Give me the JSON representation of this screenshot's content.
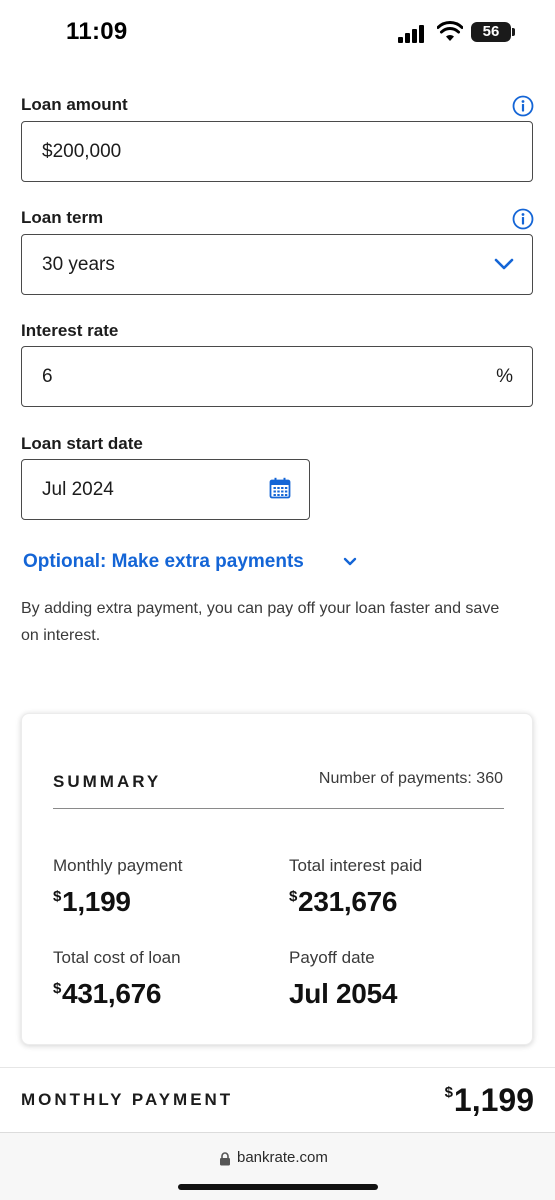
{
  "status_bar": {
    "time": "11:09",
    "battery": "56"
  },
  "form": {
    "loan_amount": {
      "label": "Loan amount",
      "value": "$200,000"
    },
    "loan_term": {
      "label": "Loan term",
      "value": "30 years"
    },
    "interest_rate": {
      "label": "Interest rate",
      "value": "6",
      "suffix": "%"
    },
    "start_date": {
      "label": "Loan start date",
      "value": "Jul 2024"
    }
  },
  "extra_payments": {
    "link": "Optional: Make extra payments",
    "description": "By adding extra payment, you can pay off your loan faster and save on interest."
  },
  "summary": {
    "title": "SUMMARY",
    "payments_count": "Number of payments: 360",
    "monthly_payment": {
      "label": "Monthly payment",
      "currency": "$",
      "value": "1,199"
    },
    "total_interest": {
      "label": "Total interest paid",
      "currency": "$",
      "value": "231,676"
    },
    "total_cost": {
      "label": "Total cost of loan",
      "currency": "$",
      "value": "431,676"
    },
    "payoff_date": {
      "label": "Payoff date",
      "value": "Jul 2054"
    }
  },
  "footer": {
    "label": "MONTHLY PAYMENT",
    "currency": "$",
    "value": "1,199"
  },
  "browser": {
    "url": "bankrate.com"
  },
  "colors": {
    "accent": "#1465d6",
    "text": "#1c1c1c",
    "muted": "#3a3a3a"
  }
}
